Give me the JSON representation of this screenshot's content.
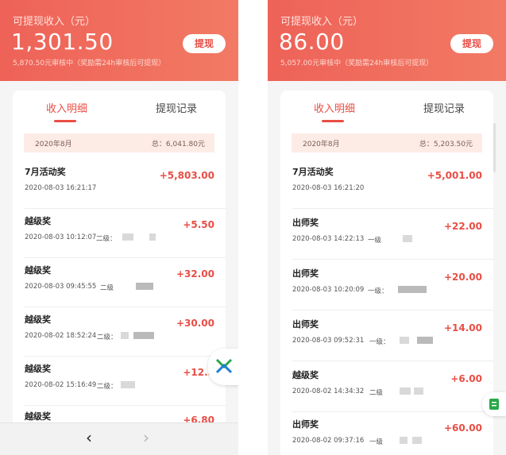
{
  "left": {
    "header": {
      "label": "可提现收入（元）",
      "amount": "1,301.50",
      "sub": "5,870.50元审核中（奖励需24h审核后可提现）",
      "withdraw_btn": "提现"
    },
    "tabs": {
      "income": "收入明细",
      "records": "提现记录"
    },
    "month": {
      "label": "2020年8月",
      "total": "总：6,041.80元"
    },
    "rows": [
      {
        "title": "7月活动奖",
        "amount": "+5,803.00",
        "time": "2020-08-03 16:21:17",
        "level": ""
      },
      {
        "title": "越级奖",
        "amount": "+5.50",
        "time": "2020-08-03 10:12:07",
        "level": "二级："
      },
      {
        "title": "越级奖",
        "amount": "+32.00",
        "time": "2020-08-03 09:45:55",
        "level": "二级"
      },
      {
        "title": "越级奖",
        "amount": "+30.00",
        "time": "2020-08-02 18:52:24",
        "level": "二级："
      },
      {
        "title": "越级奖",
        "amount": "+12.5",
        "time": "2020-08-02 15:16:49",
        "level": "二级："
      },
      {
        "title": "越级奖",
        "amount": "+6.80",
        "time": "",
        "level": ""
      }
    ],
    "nav": {
      "back": "‹",
      "forward": "›"
    },
    "floating_badge_icon": "app-logo-icon"
  },
  "right": {
    "header": {
      "label": "可提现收入（元）",
      "amount": "86.00",
      "sub": "5,057.00元审核中（奖励需24h审核后可提现）",
      "withdraw_btn": "提现"
    },
    "tabs": {
      "income": "收入明细",
      "records": "提现记录"
    },
    "month": {
      "label": "2020年8月",
      "total": "总：5,203.50元"
    },
    "rows": [
      {
        "title": "7月活动奖",
        "amount": "+5,001.00",
        "time": "2020-08-03 16:21:20",
        "level": ""
      },
      {
        "title": "出师奖",
        "amount": "+22.00",
        "time": "2020-08-03 14:22:13",
        "level": "一级"
      },
      {
        "title": "出师奖",
        "amount": "+20.00",
        "time": "2020-08-03 10:20:09",
        "level": "一级："
      },
      {
        "title": "出师奖",
        "amount": "+14.00",
        "time": "2020-08-03 09:52:31",
        "level": "一级："
      },
      {
        "title": "越级奖",
        "amount": "+6.00",
        "time": "2020-08-02 14:34:32",
        "level": "二级"
      },
      {
        "title": "出师奖",
        "amount": "+60.00",
        "time": "2020-08-02 09:37:16",
        "level": "一级"
      }
    ],
    "floating_tab_icon": "document-icon"
  },
  "colors": {
    "accent": "#e84e45",
    "header_start": "#ee6258",
    "header_end": "#f27a64"
  }
}
